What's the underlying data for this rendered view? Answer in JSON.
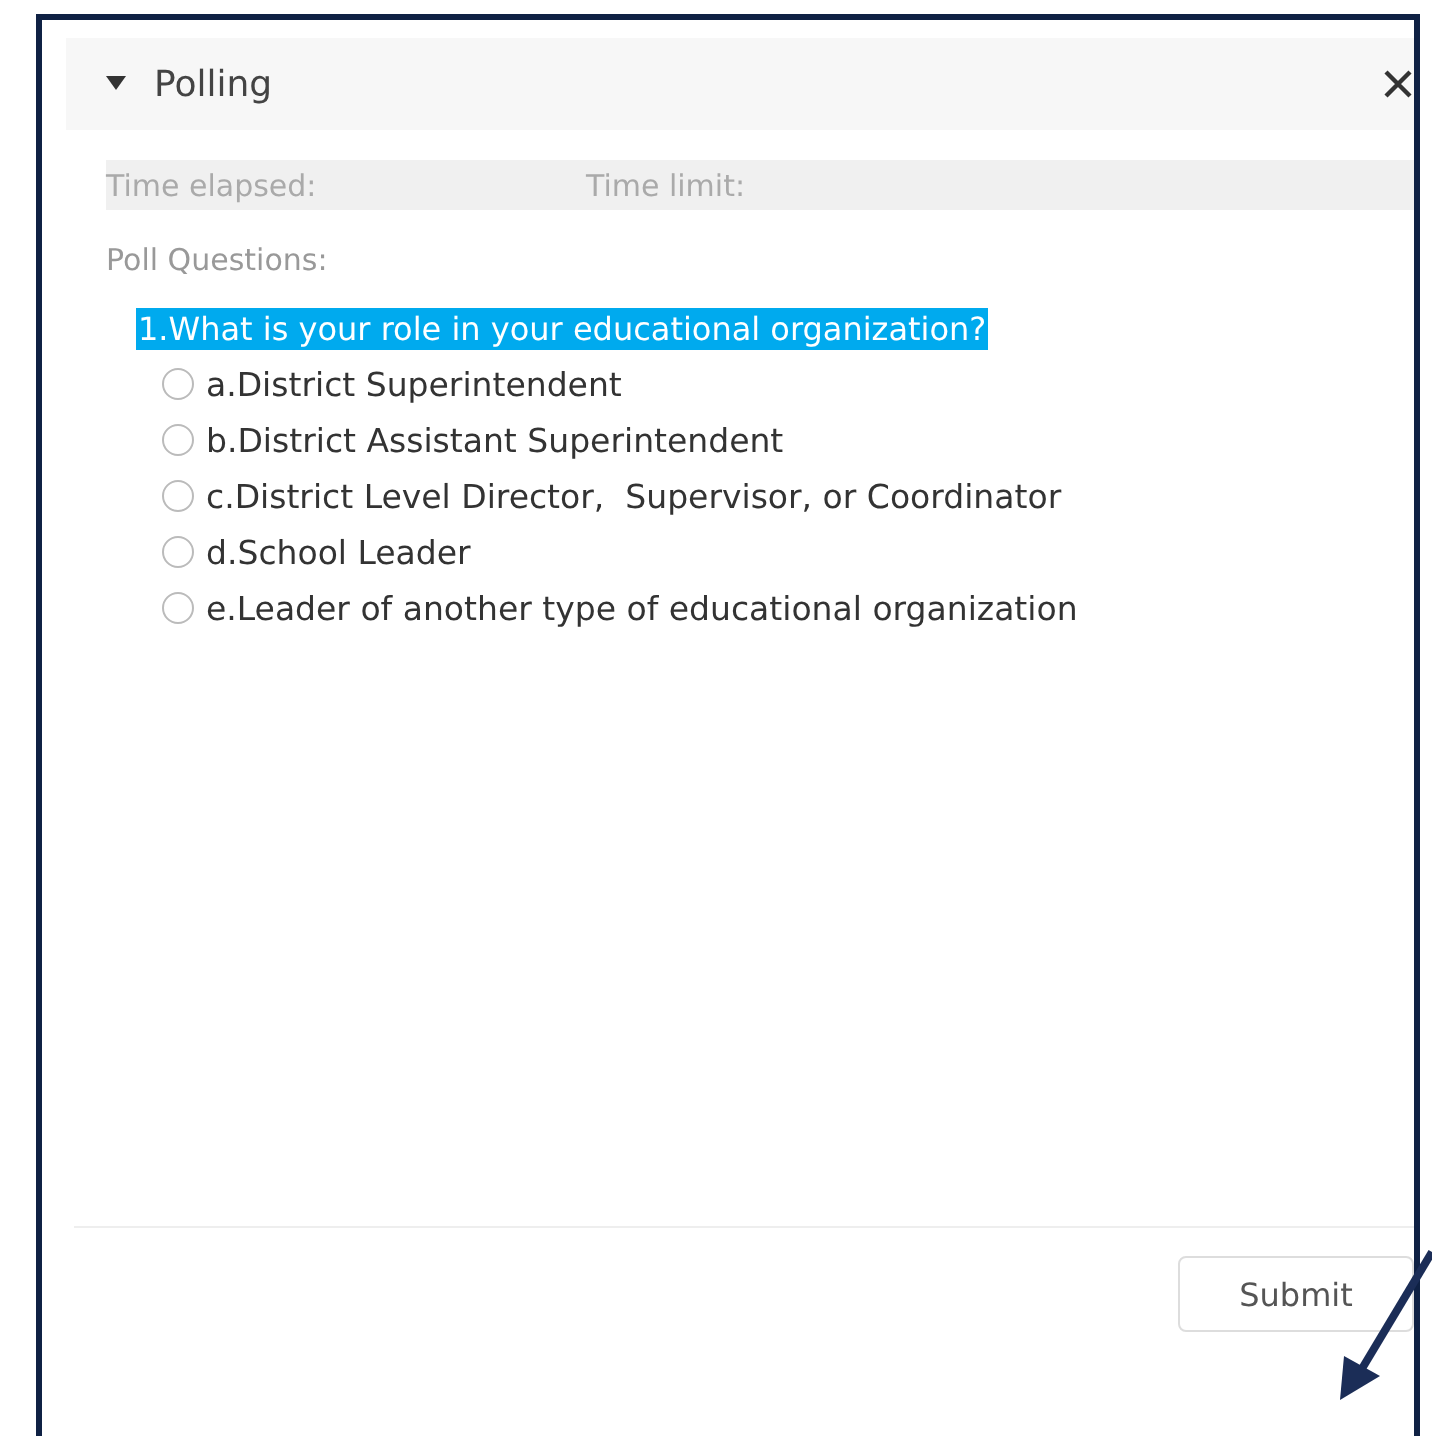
{
  "panel": {
    "title": "Polling",
    "expanded": true
  },
  "timers": {
    "elapsed_label": "Time elapsed:",
    "limit_label": "Time limit:"
  },
  "section_label": "Poll Questions:",
  "question": {
    "text": "1.What is your role in your educational organization?",
    "highlighted": true
  },
  "options": [
    {
      "label": "a.District Superintendent",
      "selected": false
    },
    {
      "label": "b.District Assistant Superintendent",
      "selected": false
    },
    {
      "label": "c.District Level Director,  Supervisor, or Coordinator",
      "selected": false
    },
    {
      "label": "d.School Leader",
      "selected": false
    },
    {
      "label": "e.Leader of another type of educational organization",
      "selected": false
    }
  ],
  "submit_button": "Submit"
}
